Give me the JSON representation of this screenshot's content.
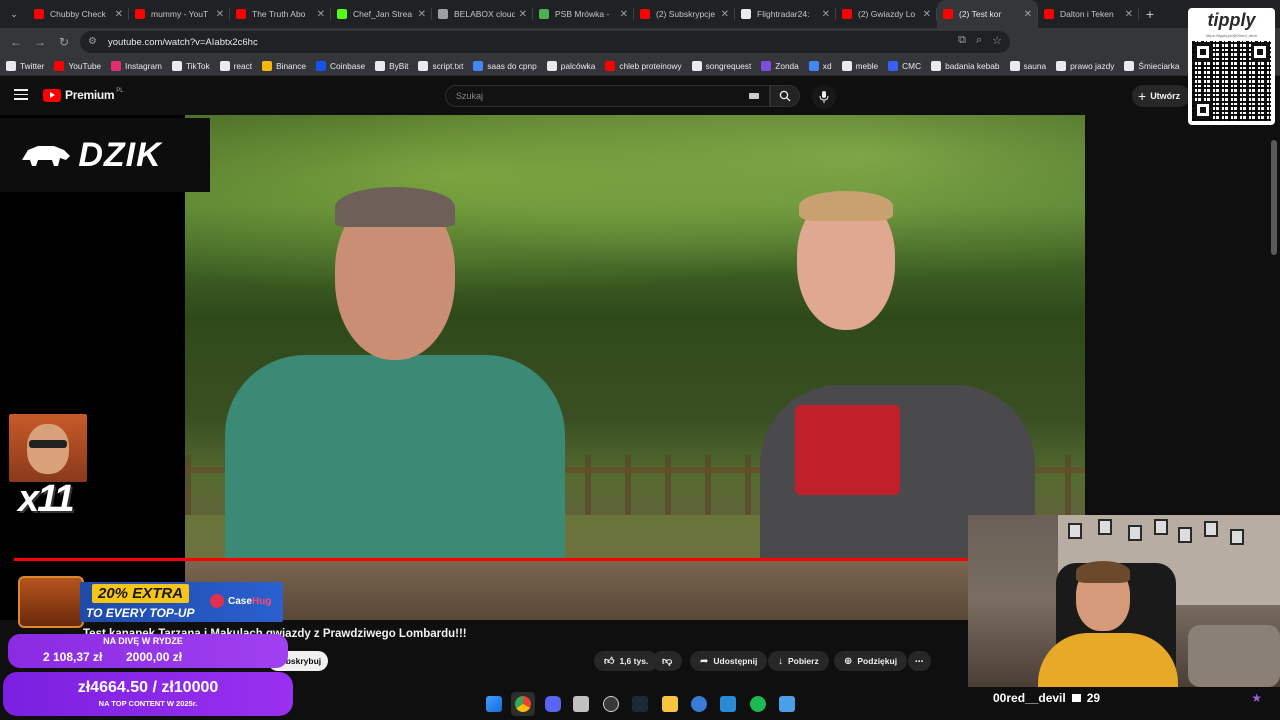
{
  "browser": {
    "tabs": [
      {
        "title": "Chubby Check",
        "favicon_color": "#ff0000"
      },
      {
        "title": "mummy - YouT",
        "favicon_color": "#ff0000"
      },
      {
        "title": "The Truth Abo",
        "favicon_color": "#ff0000"
      },
      {
        "title": "Chef_Jan Strea",
        "favicon_color": "#53fc18"
      },
      {
        "title": "BELABOX cloud",
        "favicon_color": "#9aa0a6"
      },
      {
        "title": "PSB Mrówka -",
        "favicon_color": "#4caf50"
      },
      {
        "title": "(2) Subskrypcje",
        "favicon_color": "#ff0000"
      },
      {
        "title": "Flightradar24:",
        "favicon_color": "#e8eaed"
      },
      {
        "title": "(2) Gwiazdy Lo",
        "favicon_color": "#ff0000"
      },
      {
        "title": "(2) Test kor",
        "favicon_color": "#ff0000",
        "active": true
      },
      {
        "title": "Dalton i Teken",
        "favicon_color": "#ff0000"
      }
    ],
    "url": "youtube.com/watch?v=AIabtx2c6hc",
    "bookmarks": [
      {
        "label": "Twitter",
        "color": "#e8eaed"
      },
      {
        "label": "YouTube",
        "color": "#ff0000"
      },
      {
        "label": "Instagram",
        "color": "#e1306c"
      },
      {
        "label": "TikTok",
        "color": "#e8eaed"
      },
      {
        "label": "react",
        "color": "#e8eaed"
      },
      {
        "label": "Binance",
        "color": "#f0b90b"
      },
      {
        "label": "Coinbase",
        "color": "#1652f0"
      },
      {
        "label": "ByBit",
        "color": "#e8eaed"
      },
      {
        "label": "script.txt",
        "color": "#e8eaed"
      },
      {
        "label": "saas do cpnp",
        "color": "#4285f4"
      },
      {
        "label": "palcówka",
        "color": "#e8eaed"
      },
      {
        "label": "chleb proteinowy",
        "color": "#ff0000"
      },
      {
        "label": "songrequest",
        "color": "#e8eaed"
      },
      {
        "label": "Zonda",
        "color": "#7b4fe0"
      },
      {
        "label": "xd",
        "color": "#4285f4"
      },
      {
        "label": "meble",
        "color": "#e8eaed"
      },
      {
        "label": "CMC",
        "color": "#3861fb"
      },
      {
        "label": "badania kebab",
        "color": "#e8eaed"
      },
      {
        "label": "sauna",
        "color": "#e8eaed"
      },
      {
        "label": "prawo jazdy",
        "color": "#e8eaed"
      },
      {
        "label": "Śmieciarka",
        "color": "#e8eaed"
      }
    ]
  },
  "youtube": {
    "logo_text": "Premium",
    "logo_country": "PL",
    "search_placeholder": "Szukaj",
    "create_label": "Utwórz",
    "video_title": "Test kanapek Tarzana i Makulach gwiazdy z Prawdziwego Lombardu!!!",
    "subscribe_label": "Subskrybuj",
    "likes": "1,6 tys.",
    "share_label": "Udostępnij",
    "download_label": "Pobierz",
    "thanks_label": "Podziękuj"
  },
  "overlays": {
    "dzik_logo": "DZIK",
    "emote_multiplier": "x11",
    "promo": {
      "percent": "20% EXTRA",
      "line2": "TO EVERY TOP-UP",
      "brand_a": "Case",
      "brand_b": "Hug"
    },
    "donate_goal": {
      "label": "NA DIVĘ W RYDZE",
      "current": "2 108,37 zł",
      "target": "2000,00 zł"
    },
    "top_goal": {
      "value": "zł4664.50 / zł10000",
      "subtitle": "NA TOP CONTENT W 2025r."
    },
    "tipply_name": "tipply",
    "tipply_sub": "https://tipply.pl/@00red_devil",
    "webcam_user": "00red__devil",
    "webcam_count": "29"
  },
  "colors": {
    "accent": "#ff0000",
    "donation": "#9a30f0",
    "page_bg": "#0f0f0f"
  }
}
